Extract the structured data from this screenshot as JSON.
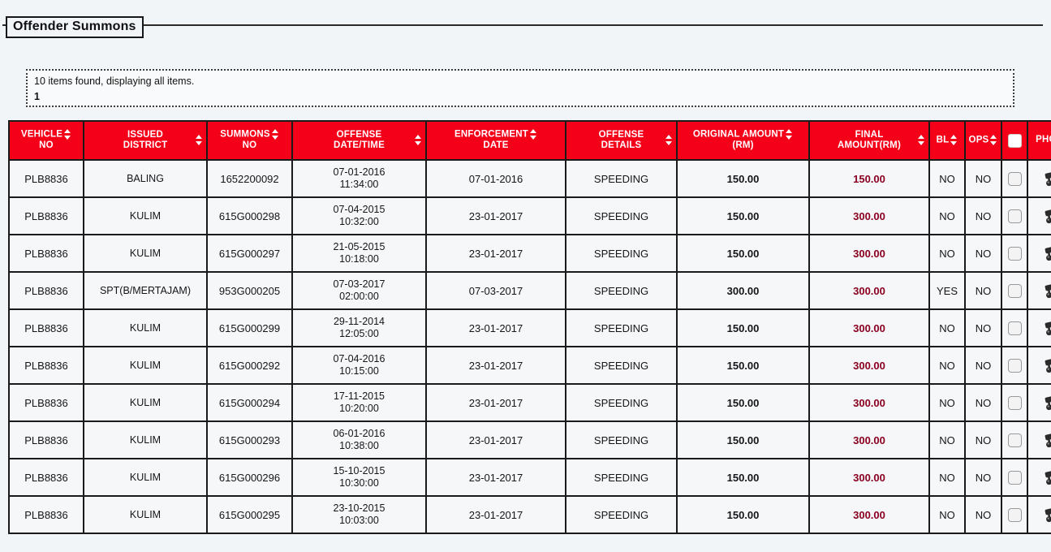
{
  "panel": {
    "legend": "Offender Summons"
  },
  "info": {
    "summary": "10 items found, displaying all items.",
    "page_indicator": "1"
  },
  "colors": {
    "header_red": "#f50019",
    "final_amount": "#8b0020",
    "page_background": "#f2f5f7",
    "cell_background": "#f5f7f8",
    "border": "#1a1a1a"
  },
  "table": {
    "columns": [
      {
        "key": "vehicle_no",
        "label_line1": "VEHICLE",
        "label_line2": "NO",
        "sortable": true,
        "sorter_position": "inline"
      },
      {
        "key": "issued_district",
        "label_line1": "ISSUED",
        "label_line2": "DISTRICT",
        "sortable": true,
        "sorter_position": "far"
      },
      {
        "key": "summons_no",
        "label_line1": "SUMMONS",
        "label_line2": "NO",
        "sortable": true,
        "sorter_position": "inline"
      },
      {
        "key": "offense_datetime",
        "label_line1": "OFFENSE",
        "label_line2": "DATE/TIME",
        "sortable": true,
        "sorter_position": "far"
      },
      {
        "key": "enforcement_date",
        "label_line1": "ENFORCEMENT",
        "label_line2": "DATE",
        "sortable": true,
        "sorter_position": "inline"
      },
      {
        "key": "offense_details",
        "label_line1": "OFFENSE",
        "label_line2": "DETAILS",
        "sortable": true,
        "sorter_position": "far"
      },
      {
        "key": "original_amount",
        "label_line1": "ORIGINAL AMOUNT",
        "label_line2": "(RM)",
        "sortable": true,
        "sorter_position": "inline"
      },
      {
        "key": "final_amount",
        "label_line1": "FINAL",
        "label_line2": "AMOUNT(RM)",
        "sortable": true,
        "sorter_position": "far"
      },
      {
        "key": "bl",
        "label_line1": "BL",
        "label_line2": "",
        "sortable": true,
        "sorter_position": "inline"
      },
      {
        "key": "ops",
        "label_line1": "OPS",
        "label_line2": "",
        "sortable": true,
        "sorter_position": "inline"
      },
      {
        "key": "select_all",
        "label_line1": "",
        "label_line2": "",
        "sortable": false,
        "sorter_position": "none",
        "control": "checkbox"
      },
      {
        "key": "photo",
        "label_line1": "PHOTO",
        "label_line2": "",
        "sortable": false,
        "sorter_position": "none"
      }
    ],
    "rows": [
      {
        "vehicle_no": "PLB8836",
        "issued_district": "BALING",
        "summons_no": "1652200092",
        "offense_date": "07-01-2016",
        "offense_time": "11:34:00",
        "enforcement_date": "07-01-2016",
        "offense_details": "SPEEDING",
        "original_amount": "150.00",
        "final_amount": "150.00",
        "bl": "NO",
        "ops": "NO",
        "selected": false,
        "photo_icon": "cctv-camera-icon"
      },
      {
        "vehicle_no": "PLB8836",
        "issued_district": "KULIM",
        "summons_no": "615G000298",
        "offense_date": "07-04-2015",
        "offense_time": "10:32:00",
        "enforcement_date": "23-01-2017",
        "offense_details": "SPEEDING",
        "original_amount": "150.00",
        "final_amount": "300.00",
        "bl": "NO",
        "ops": "NO",
        "selected": false,
        "photo_icon": "cctv-camera-icon"
      },
      {
        "vehicle_no": "PLB8836",
        "issued_district": "KULIM",
        "summons_no": "615G000297",
        "offense_date": "21-05-2015",
        "offense_time": "10:18:00",
        "enforcement_date": "23-01-2017",
        "offense_details": "SPEEDING",
        "original_amount": "150.00",
        "final_amount": "300.00",
        "bl": "NO",
        "ops": "NO",
        "selected": false,
        "photo_icon": "cctv-camera-icon"
      },
      {
        "vehicle_no": "PLB8836",
        "issued_district": "SPT(B/MERTAJAM)",
        "summons_no": "953G000205",
        "offense_date": "07-03-2017",
        "offense_time": "02:00:00",
        "enforcement_date": "07-03-2017",
        "offense_details": "SPEEDING",
        "original_amount": "300.00",
        "final_amount": "300.00",
        "bl": "YES",
        "ops": "NO",
        "selected": false,
        "photo_icon": "cctv-camera-icon"
      },
      {
        "vehicle_no": "PLB8836",
        "issued_district": "KULIM",
        "summons_no": "615G000299",
        "offense_date": "29-11-2014",
        "offense_time": "12:05:00",
        "enforcement_date": "23-01-2017",
        "offense_details": "SPEEDING",
        "original_amount": "150.00",
        "final_amount": "300.00",
        "bl": "NO",
        "ops": "NO",
        "selected": false,
        "photo_icon": "cctv-camera-icon"
      },
      {
        "vehicle_no": "PLB8836",
        "issued_district": "KULIM",
        "summons_no": "615G000292",
        "offense_date": "07-04-2016",
        "offense_time": "10:15:00",
        "enforcement_date": "23-01-2017",
        "offense_details": "SPEEDING",
        "original_amount": "150.00",
        "final_amount": "300.00",
        "bl": "NO",
        "ops": "NO",
        "selected": false,
        "photo_icon": "cctv-camera-icon"
      },
      {
        "vehicle_no": "PLB8836",
        "issued_district": "KULIM",
        "summons_no": "615G000294",
        "offense_date": "17-11-2015",
        "offense_time": "10:20:00",
        "enforcement_date": "23-01-2017",
        "offense_details": "SPEEDING",
        "original_amount": "150.00",
        "final_amount": "300.00",
        "bl": "NO",
        "ops": "NO",
        "selected": false,
        "photo_icon": "cctv-camera-icon"
      },
      {
        "vehicle_no": "PLB8836",
        "issued_district": "KULIM",
        "summons_no": "615G000293",
        "offense_date": "06-01-2016",
        "offense_time": "10:38:00",
        "enforcement_date": "23-01-2017",
        "offense_details": "SPEEDING",
        "original_amount": "150.00",
        "final_amount": "300.00",
        "bl": "NO",
        "ops": "NO",
        "selected": false,
        "photo_icon": "cctv-camera-icon"
      },
      {
        "vehicle_no": "PLB8836",
        "issued_district": "KULIM",
        "summons_no": "615G000296",
        "offense_date": "15-10-2015",
        "offense_time": "10:30:00",
        "enforcement_date": "23-01-2017",
        "offense_details": "SPEEDING",
        "original_amount": "150.00",
        "final_amount": "300.00",
        "bl": "NO",
        "ops": "NO",
        "selected": false,
        "photo_icon": "cctv-camera-icon"
      },
      {
        "vehicle_no": "PLB8836",
        "issued_district": "KULIM",
        "summons_no": "615G000295",
        "offense_date": "23-10-2015",
        "offense_time": "10:03:00",
        "enforcement_date": "23-01-2017",
        "offense_details": "SPEEDING",
        "original_amount": "150.00",
        "final_amount": "300.00",
        "bl": "NO",
        "ops": "NO",
        "selected": false,
        "photo_icon": "cctv-camera-icon"
      }
    ]
  }
}
